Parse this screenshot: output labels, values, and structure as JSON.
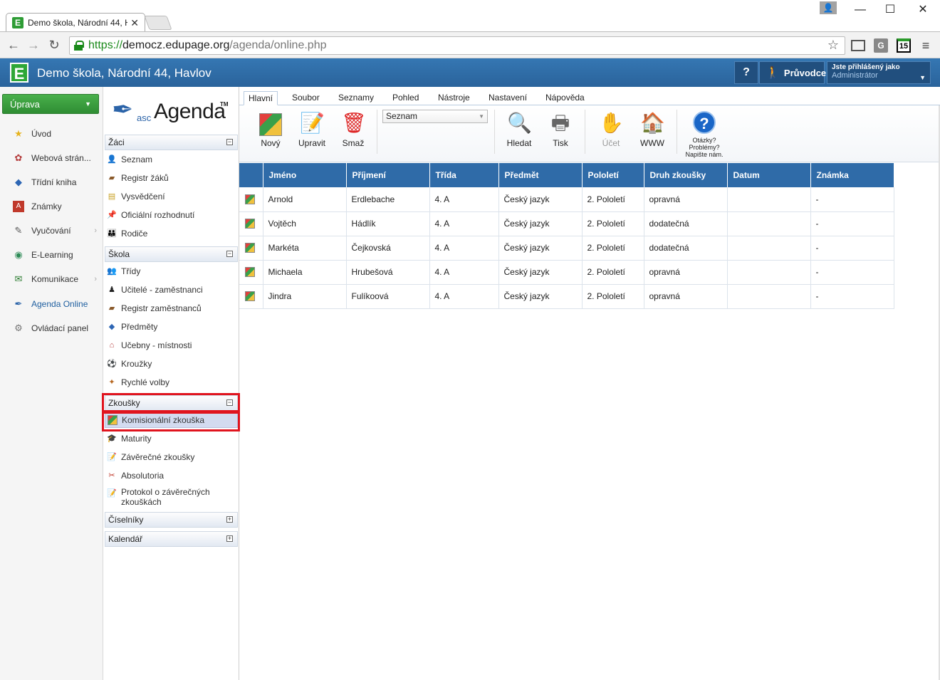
{
  "browser": {
    "tab_title": "Demo škola, Národní 44, H",
    "tab_favicon": "E",
    "url_scheme": "https://",
    "url_host": "democz.edupage.org",
    "url_path": "/agenda/online.php",
    "ext_g": "G",
    "ext_15": "15"
  },
  "app": {
    "logo": "E",
    "title": "Demo škola, Národní 44, Havlov",
    "help_label": "?",
    "guide_label": "Průvodce",
    "login_label": "Jste přihlášený jako",
    "login_user": "Administrátor"
  },
  "leftnav": {
    "edit_label": "Úprava",
    "items": [
      {
        "label": "Úvod",
        "icon": "star-icon"
      },
      {
        "label": "Webová strán...",
        "icon": "web-icon"
      },
      {
        "label": "Třídní kniha",
        "icon": "book-icon"
      },
      {
        "label": "Známky",
        "icon": "grades-icon"
      },
      {
        "label": "Vyučování",
        "icon": "teaching-icon"
      },
      {
        "label": "E-Learning",
        "icon": "elearning-icon"
      },
      {
        "label": "Komunikace",
        "icon": "communication-icon"
      },
      {
        "label": "Agenda Online",
        "icon": "agenda-pen-icon"
      },
      {
        "label": "Ovládací panel",
        "icon": "control-panel-icon"
      }
    ]
  },
  "agenda": {
    "logo_asc": "asc",
    "logo_main": "Agenda",
    "logo_tm": "TM",
    "sections": {
      "zaci": {
        "title": "Žáci",
        "toggle": "−",
        "items": [
          "Seznam",
          "Registr žáků",
          "Vysvědčení",
          "Oficiální rozhodnutí",
          "Rodiče"
        ]
      },
      "skola": {
        "title": "Škola",
        "toggle": "−",
        "items": [
          "Třídy",
          "Učitelé - zaměstnanci",
          "Registr zaměstnanců",
          "Předměty",
          "Učebny - místnosti",
          "Kroužky",
          "Rychlé volby"
        ]
      },
      "zkousky": {
        "title": "Zkoušky",
        "toggle": "−",
        "items": [
          "Komisionální zkouška",
          "Maturity",
          "Závěrečné zkoušky",
          "Absolutoria",
          "Protokol o závěrečných zkouškách"
        ]
      },
      "ciselniky": {
        "title": "Číselníky",
        "toggle": "+"
      },
      "kalendar": {
        "title": "Kalendář",
        "toggle": "+"
      }
    }
  },
  "ribbon": {
    "tabs": [
      "Hlavní",
      "Soubor",
      "Seznamy",
      "Pohled",
      "Nástroje",
      "Nastavení",
      "Nápověda"
    ],
    "active_tab": "Hlavní",
    "buttons": {
      "new": "Nový",
      "edit": "Upravit",
      "delete": "Smaž",
      "search": "Hledat",
      "print": "Tisk",
      "account": "Účet",
      "www": "WWW"
    },
    "view_select": "Seznam",
    "help_text": [
      "Otázky?",
      "Problémy?",
      "Napište nám."
    ]
  },
  "table": {
    "columns": [
      "Jméno",
      "Příjmení",
      "Třída",
      "Předmět",
      "Pololetí",
      "Druh zkoušky",
      "Datum",
      "Známka"
    ],
    "rows": [
      [
        "Arnold",
        "Erdlebache",
        "4. A",
        "Český jazyk",
        "2. Pololetí",
        "opravná",
        "",
        "-"
      ],
      [
        "Vojtěch",
        "Hádlík",
        "4. A",
        "Český jazyk",
        "2. Pololetí",
        "dodatečná",
        "",
        "-"
      ],
      [
        "Markéta",
        "Čejkovská",
        "4. A",
        "Český jazyk",
        "2. Pololetí",
        "dodatečná",
        "",
        "-"
      ],
      [
        "Michaela",
        "Hrubešová",
        "4. A",
        "Český jazyk",
        "2. Pololetí",
        "opravná",
        "",
        "-"
      ],
      [
        "Jindra",
        "Fulíkoová",
        "4. A",
        "Český jazyk",
        "2. Pololetí",
        "opravná",
        "",
        "-"
      ]
    ]
  },
  "colors": {
    "appbar": "#2f6ba8",
    "edit_button": "#3a9c3d",
    "highlight": "#e0141e"
  }
}
